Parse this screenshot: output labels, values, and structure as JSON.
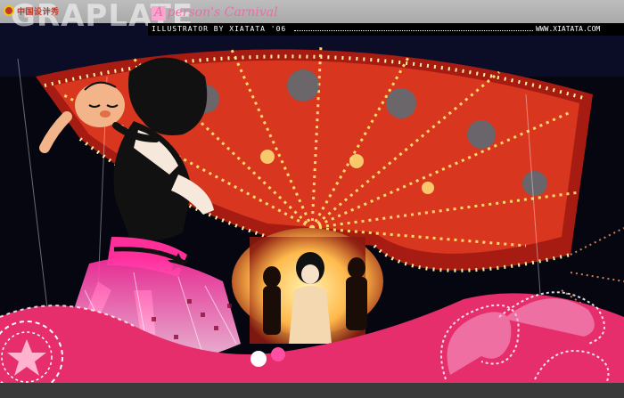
{
  "header": {
    "logo_text": "中国设计秀",
    "brand_word": "GRAPLATE",
    "title": "A person's Carnival"
  },
  "credit": {
    "left": "ILLUSTRATOR BY XIATATA '06",
    "right": "WWW.XIATATA.COM"
  },
  "colors": {
    "pink_band": "#e52e6b",
    "carousel_red": "#d9361f",
    "light_yellow": "#ffd86b",
    "skirt_pink": "#ff5db4",
    "background": "#05060f"
  }
}
